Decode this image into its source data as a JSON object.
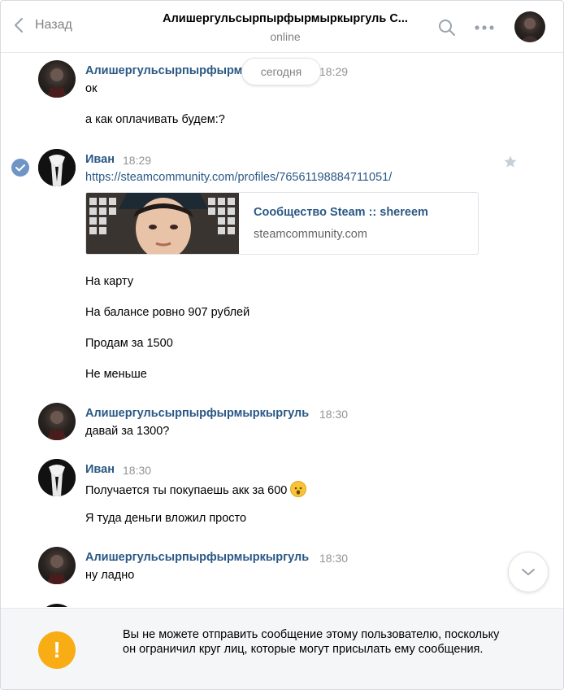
{
  "header": {
    "back_label": "Назад",
    "title": "Алишергульсырпырфырмыркыргуль С...",
    "status": "online"
  },
  "date_divider": "сегодня",
  "messages": [
    {
      "author": "Алишергульсырпырфырмыркыргуль",
      "time": "18:29",
      "lines": [
        "ок",
        "а как оплачивать будем:?"
      ]
    },
    {
      "author": "Иван",
      "time": "18:29",
      "link": "https://steamcommunity.com/profiles/76561198884711051/",
      "card": {
        "title": "Сообщество Steam :: shereem",
        "domain": "steamcommunity.com"
      },
      "lines": [
        "На карту",
        "На балансе ровно 907 рублей",
        "Продам за 1500",
        "Не меньше"
      ]
    },
    {
      "author": "Алишергульсырпырфырмыркыргуль",
      "time": "18:30",
      "lines": [
        "давай за 1300?"
      ]
    },
    {
      "author": "Иван",
      "time": "18:30",
      "lines": [
        "Получается ты покупаешь акк за 600",
        "Я туда деньги вложил просто"
      ]
    },
    {
      "author": "Алишергульсырпырфырмыркыргуль",
      "time": "18:30",
      "lines": [
        "ну ладно"
      ]
    }
  ],
  "notice": {
    "text": "Вы не можете отправить сообщение этому пользователю, поскольку он ограничил круг лиц, которые могут присылать ему сообщения.",
    "icon_char": "!"
  },
  "icons": [
    "chevron-left-icon",
    "search-icon",
    "more-icon",
    "star-icon",
    "check-icon",
    "chevron-down-icon",
    "warning-icon",
    "emoji-icon"
  ],
  "colors": {
    "link": "#2a5885",
    "accent": "#6f95c6",
    "warning": "#f9ad15"
  }
}
